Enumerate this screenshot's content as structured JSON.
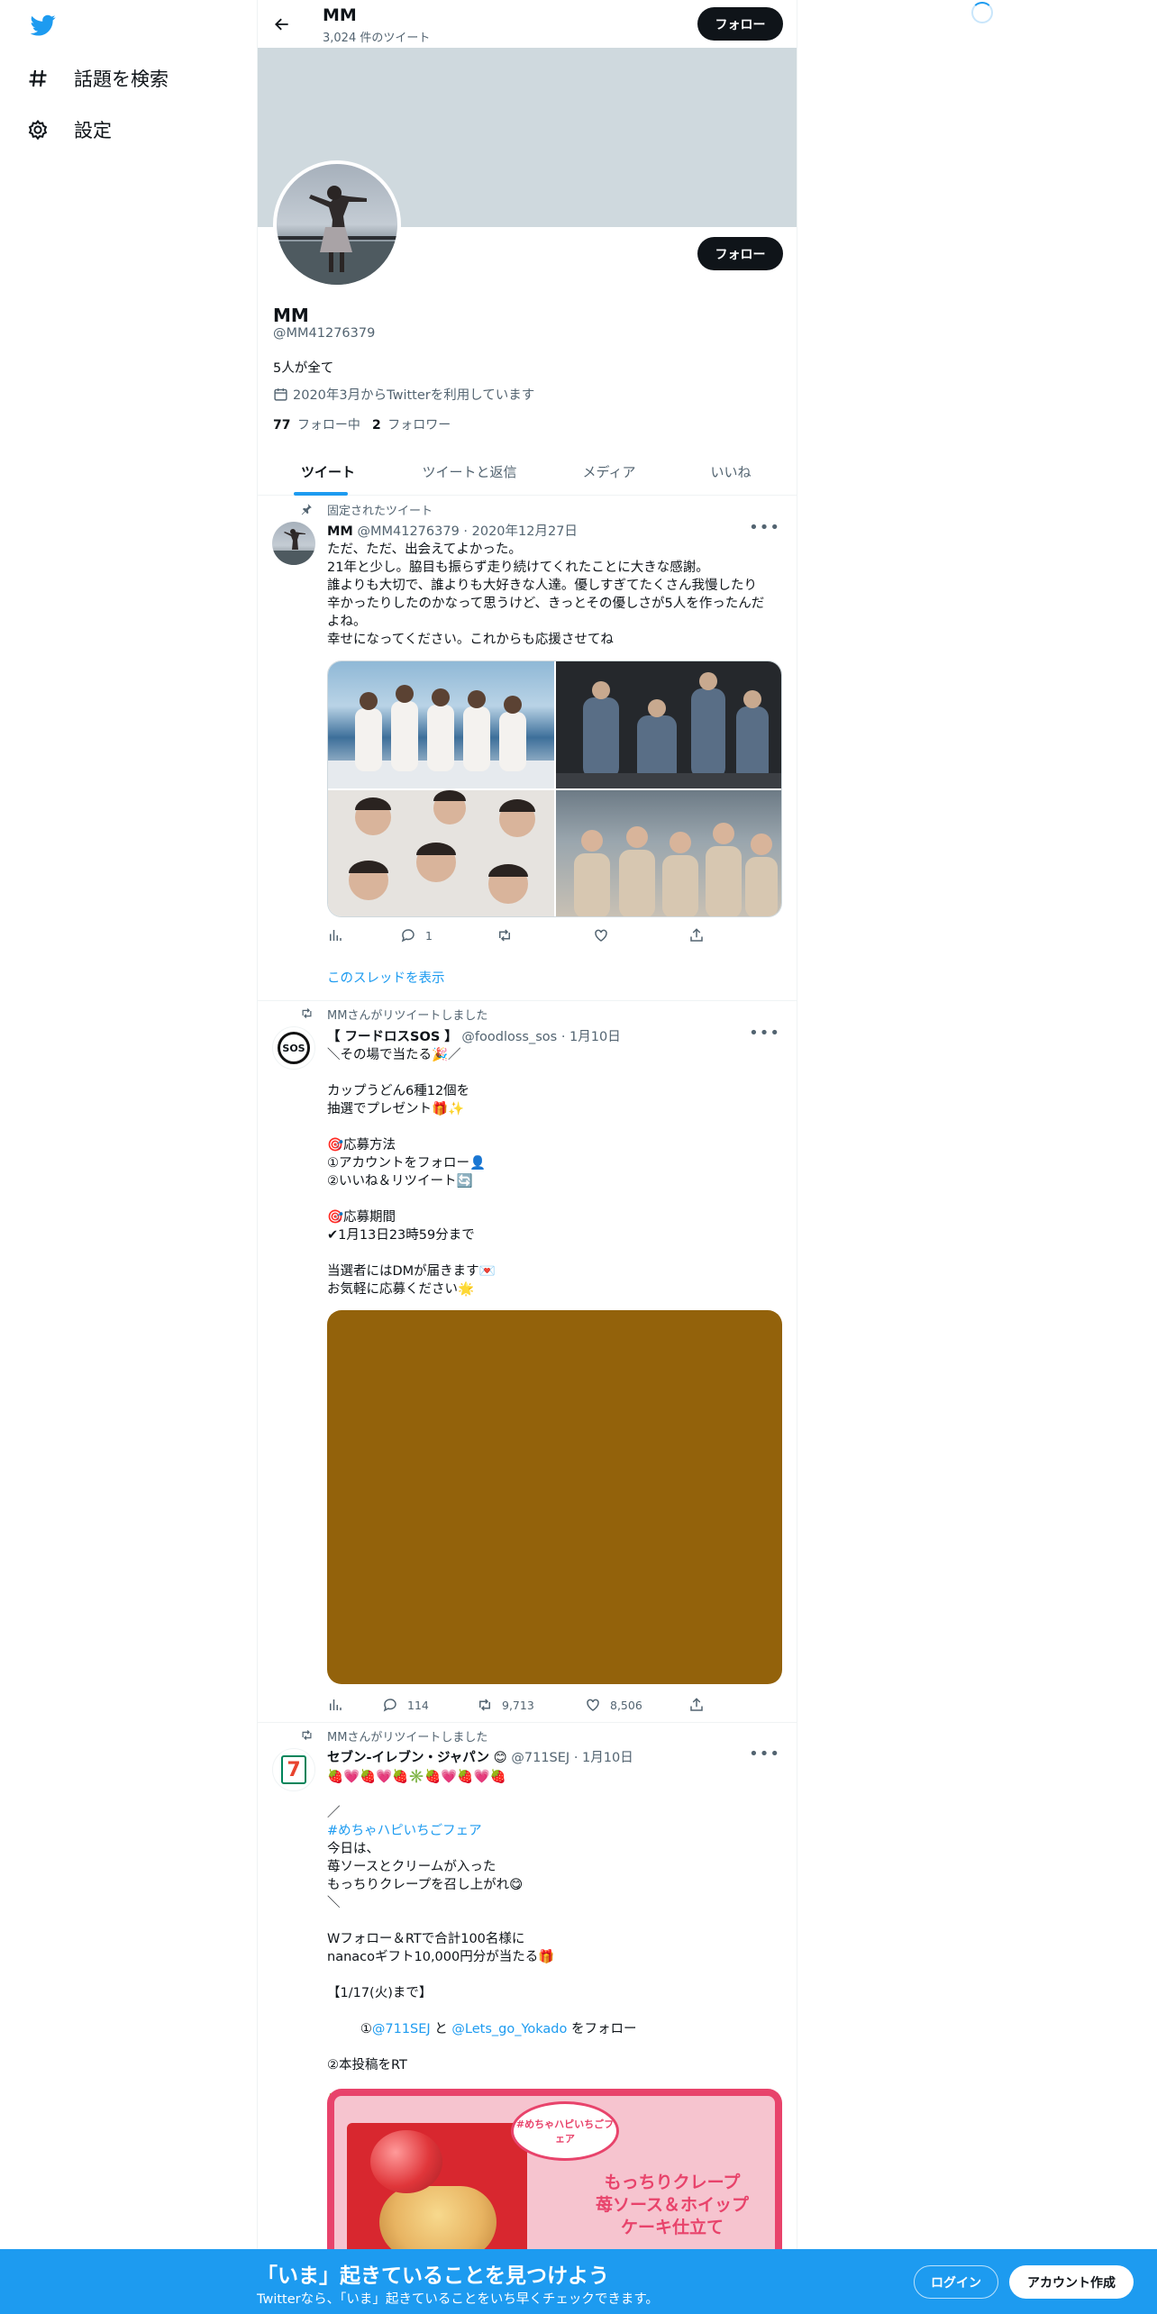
{
  "nav": {
    "explore_label": "話題を検索",
    "settings_label": "設定"
  },
  "header": {
    "name": "MM",
    "tweet_count": "3,024 件のツイート",
    "follow_label": "フォロー"
  },
  "profile": {
    "name": "MM",
    "handle": "@MM41276379",
    "bio": "5人が全て",
    "joined": "2020年3月からTwitterを利用しています",
    "following_count": "77",
    "following_label": "フォロー中",
    "followers_count": "2",
    "followers_label": "フォロワー",
    "follow_label": "フォロー"
  },
  "tabs": [
    {
      "label": "ツイート"
    },
    {
      "label": "ツイートと返信"
    },
    {
      "label": "メディア"
    },
    {
      "label": "いいね"
    }
  ],
  "tweets": [
    {
      "context": "固定されたツイート",
      "name": "MM",
      "handle": "@MM41276379",
      "dot": "·",
      "date": "2020年12月27日",
      "text": "ただ、ただ、出会えてよかった。\n21年と少し。脇目も振らず走り続けてくれたことに大きな感謝。\n誰よりも大切で、誰よりも大好きな人達。優しすぎてたくさん我慢したり\n辛かったりしたのかなって思うけど、きっとその優しさが5人を作ったんだ\nよね。\n幸せになってください。これからも応援させてね",
      "reply_count": "1",
      "retweet_count": "",
      "like_count": "",
      "thread_link": "このスレッドを表示"
    },
    {
      "context": "MMさんがリツイートしました",
      "name": "【 フードロスSOS 】",
      "handle": "@foodloss_sos",
      "dot": "·",
      "date": "1月10日",
      "text": "＼その場で当たる🎉／\n\nカップうどん6種12個を\n抽選でプレゼント🎁✨\n\n🎯応募方法\n①アカウントをフォロー👤\n②いいね＆リツイート🔄\n\n🎯応募期間\n✔1月13日23時59分まで\n\n当選者にはDMが届きます💌\nお気軽に応募ください🌟",
      "avatar_text": "SOS",
      "reply_count": "114",
      "retweet_count": "9,713",
      "like_count": "8,506"
    },
    {
      "context": "MMさんがリツイートしました",
      "name": "セブン-イレブン・ジャパン",
      "badge": "😊",
      "handle": "@711SEJ",
      "dot": "·",
      "date": "1月10日",
      "avatar_text": "7",
      "text_1": "🍓💗🍓💗🍓✳️🍓💗🍓💗🍓\n\n／",
      "hashtag": "#めちゃハピいちごフェア",
      "text_2": "今日は、\n苺ソースとクリームが入った\nもっちりクレープを召し上がれ😋\n＼\n\nWフォロー＆RTで合計100名様に\nnanacoギフト10,000円分が当たる🎁\n\n【1/17(火)まで】",
      "mention_prefix": "①",
      "mention_1": "@711SEJ",
      "mention_and": " と ",
      "mention_2": "@Lets_go_Yokado",
      "mention_suffix": " をフォロー",
      "text_3": "②本投稿をRT\n\n🍓💗🍓💗🍓✳️🍓💗🍓💗🍓",
      "promo_title": "#めちゃハピいちごフェア",
      "promo_line1": "もっちりクレープ",
      "promo_line2": "苺ソース＆ホイップ",
      "promo_line3": "ケーキ仕立て"
    }
  ],
  "bottom_bar": {
    "title": "「いま」起きていることを見つけよう",
    "subtitle": "Twitterなら、「いま」起きていることをいち早くチェックできます。",
    "login_label": "ログイン",
    "signup_label": "アカウント作成"
  },
  "colors": {
    "brand_blue": "#1d9bf0",
    "banner_gray": "#cfd9de",
    "dark_button": "#0f1419",
    "media_brown": "#93620b",
    "promo_pink": "#e8436b"
  }
}
